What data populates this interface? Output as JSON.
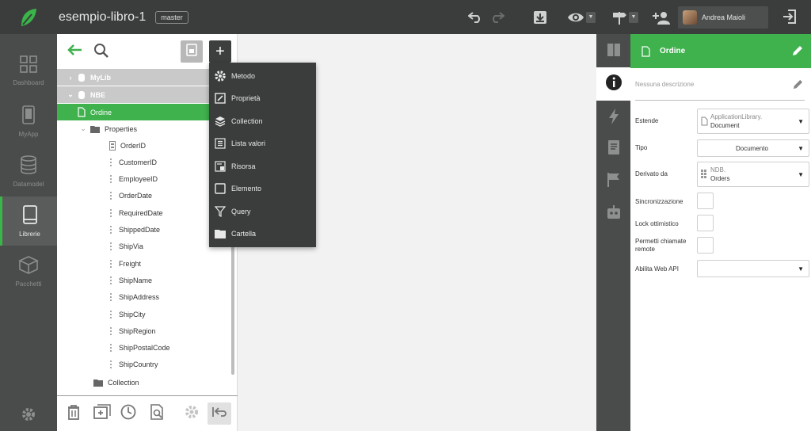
{
  "header": {
    "app_title": "esempio-libro-1",
    "branch": "master",
    "user_name": "Andrea Maioli",
    "icons": [
      "undo-icon",
      "redo-icon",
      "download-icon",
      "eye-icon",
      "signpost-icon",
      "add-user-icon",
      "exit-icon"
    ]
  },
  "leftnav": {
    "items": [
      {
        "label": "Dashboard",
        "icon": "dashboard-icon"
      },
      {
        "label": "MyApp",
        "icon": "phone-icon"
      },
      {
        "label": "Datamodel",
        "icon": "database-icon"
      },
      {
        "label": "Librerie",
        "icon": "book-icon",
        "active": true
      },
      {
        "label": "Pacchetti",
        "icon": "package-icon"
      }
    ]
  },
  "tree": {
    "libraries": [
      "MyLib",
      "NBE"
    ],
    "selected": "Ordine",
    "group": "Properties",
    "properties": [
      "OrderID",
      "CustomerID",
      "EmployeeID",
      "OrderDate",
      "RequiredDate",
      "ShippedDate",
      "ShipVia",
      "Freight",
      "ShipName",
      "ShipAddress",
      "ShipCity",
      "ShipRegion",
      "ShipPostalCode",
      "ShipCountry"
    ],
    "collection": "Collection"
  },
  "menu": {
    "items": [
      {
        "label": "Metodo",
        "icon": "gear-icon"
      },
      {
        "label": "Proprietà",
        "icon": "edit-box-icon"
      },
      {
        "label": "Collection",
        "icon": "layers-icon"
      },
      {
        "label": "Lista valori",
        "icon": "list-icon"
      },
      {
        "label": "Risorsa",
        "icon": "resource-icon"
      },
      {
        "label": "Elemento",
        "icon": "square-icon"
      },
      {
        "label": "Query",
        "icon": "filter-icon"
      },
      {
        "label": "Cartella",
        "icon": "folder-icon"
      }
    ]
  },
  "props": {
    "title": "Ordine",
    "description_placeholder": "Nessuna descrizione",
    "estende_label": "Estende",
    "estende_line1": "ApplicationLibrary.",
    "estende_line2": "Document",
    "tipo_label": "Tipo",
    "tipo_value": "Documento",
    "derivato_label": "Derivato da",
    "derivato_line1": "NDB.",
    "derivato_line2": "Orders",
    "sync_label": "Sincronizzazione",
    "lock_label": "Lock ottimistico",
    "remote_label": "Permetti chiamate remote",
    "webapi_label": "Abilita Web API",
    "webapi_value": ""
  },
  "colors": {
    "accent": "#3fb14d",
    "topbar": "#3b3d3c",
    "sidebar": "#4a4c4b"
  }
}
